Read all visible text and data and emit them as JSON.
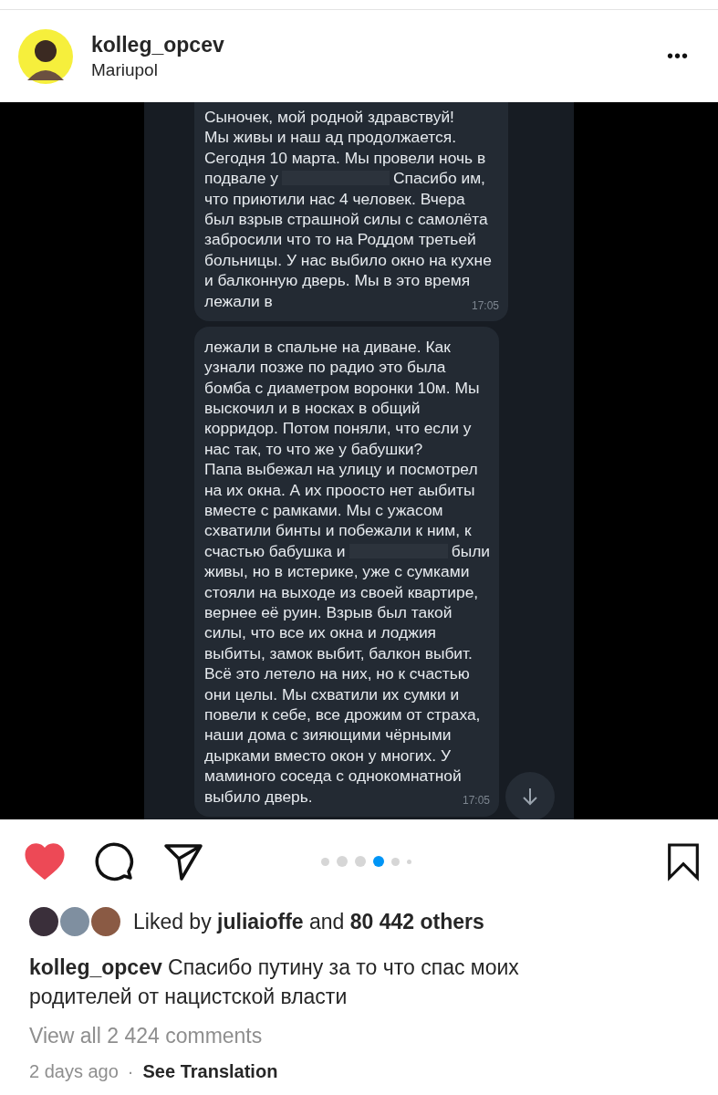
{
  "post_header": {
    "username": "kolleg_opcev",
    "location": "Mariupol",
    "more_icon": "•••"
  },
  "chat_messages": [
    {
      "top_cut": true,
      "time": "17:05",
      "lines": [
        [
          "Сыночек, мой родной здравствуй!"
        ],
        [
          "Мы живы и наш ад продолжается."
        ],
        [
          "Сегодня 10 марта. Мы провели ночь в"
        ],
        [
          "подвале у",
          "Спасибо им,"
        ],
        [
          "что приютили нас 4 человек. Вчера"
        ],
        [
          "был взрыв страшной силы с самолёта"
        ],
        [
          "забросили что то на Роддом третьей"
        ],
        [
          "больницы. У нас выбило окно на кухне"
        ],
        [
          "и балконную дверь. Мы в это время"
        ],
        [
          "лежали в"
        ]
      ]
    },
    {
      "top_cut": false,
      "time": "17:05",
      "lines": [
        [
          "лежали в спальне на диване. Как"
        ],
        [
          "узнали позже по радио это была"
        ],
        [
          "бомба с диаметром воронки 10м. Мы"
        ],
        [
          "выскочил и в носках в общий"
        ],
        [
          "корридор. Потом поняли, что если у"
        ],
        [
          "нас так, то что же у бабушки?"
        ],
        [
          "Папа выбежал на улицу и посмотрел"
        ],
        [
          "на их окна. А их проосто нет аыбиты"
        ],
        [
          "вместе с рамками. Мы с ужасом"
        ],
        [
          "схватили бинты и побежали к ним, к"
        ],
        [
          "счастью бабушка и",
          "были"
        ],
        [
          "живы, но в истерике, уже с сумками"
        ],
        [
          "стояли на выходе из своей квартире,"
        ],
        [
          "вернее её руин. Взрыв был такой"
        ],
        [
          "силы, что все их окна и лоджия"
        ],
        [
          "выбиты, замок выбит, балкон выбит."
        ],
        [
          "Всё это летело на них, но к счастью"
        ],
        [
          "они целы. Мы схватили их сумки и"
        ],
        [
          "повели к себе, все дрожим от страха,"
        ],
        [
          "наши дома с зияющими чёрными"
        ],
        [
          "дырками вместо окон у многих. У"
        ],
        [
          "маминого соседа с однокомнатной"
        ],
        [
          "выбило дверь."
        ]
      ]
    }
  ],
  "actions": {
    "liked": true,
    "saved": false
  },
  "carousel_dots": [
    {
      "kind": "small",
      "selected": false
    },
    {
      "kind": "large",
      "selected": false
    },
    {
      "kind": "large",
      "selected": false
    },
    {
      "kind": "large",
      "selected": true
    },
    {
      "kind": "small",
      "selected": false
    },
    {
      "kind": "tiny",
      "selected": false
    }
  ],
  "likes": {
    "prefix": "Liked by",
    "user": "juliaioffe",
    "middle": "and",
    "count": "80 442 others",
    "avatars": [
      {
        "color": "#3a2f3a"
      },
      {
        "color": "#7f8fa0"
      },
      {
        "color": "#8a5a44"
      }
    ]
  },
  "caption": {
    "username": "kolleg_opcev",
    "text": "Спасибо путину за то что спас моих родителей от нацистской власти"
  },
  "view_comments": "View all 2 424 comments",
  "footer": {
    "time": "2 days ago",
    "separator": "·",
    "translate": "See Translation"
  }
}
